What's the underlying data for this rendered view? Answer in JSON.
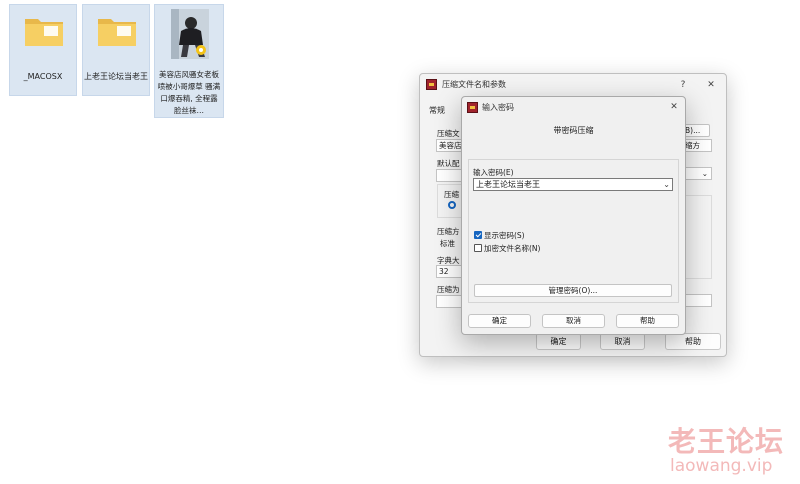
{
  "desktop": {
    "items": [
      {
        "label": "_MACOSX"
      },
      {
        "label": "上老王论坛当老王"
      },
      {
        "label": "美容店风骚女老板喷被小哥爆草 骚满口爆吞精, 全程露脸丝袜…"
      }
    ]
  },
  "back_dialog": {
    "title": "压缩文件名和参数",
    "help_char": "?",
    "close_char": "✕",
    "tab": "常规",
    "label_archive_name": "压缩文",
    "archive_name_value": "美容店",
    "browse_suffix": "B)...",
    "update_suffix": "缩方",
    "label_default": "默认配",
    "label_format": "压缩",
    "label_method": "压缩方",
    "method_value": "标准",
    "label_dict": "字典大",
    "dict_value": "32",
    "label_split": "压缩为",
    "btn_ok": "确定",
    "btn_cancel": "取消",
    "btn_help": "帮助"
  },
  "front_dialog": {
    "title": "输入密码",
    "close_char": "✕",
    "heading": "带密码压缩",
    "password_label": "输入密码(E)",
    "password_value": "上老王论坛当老王",
    "show_password_label": "显示密码(S)",
    "show_password_checked": true,
    "encrypt_names_label": "加密文件名称(N)",
    "encrypt_names_checked": false,
    "manage_button": "管理密码(O)...",
    "btn_ok": "确定",
    "btn_cancel": "取消",
    "btn_help": "帮助"
  },
  "watermark": {
    "line1": "老王论坛",
    "line2": "laowang.vip"
  }
}
